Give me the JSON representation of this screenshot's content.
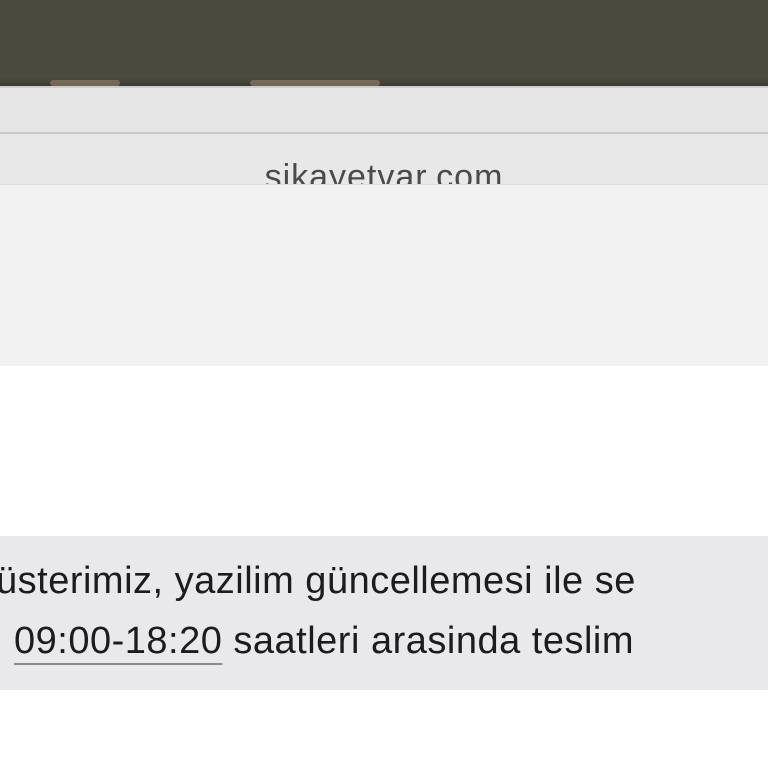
{
  "browser": {
    "address": "sikayetvar.com"
  },
  "message": {
    "line1": "üsterimiz, yazilim güncellemesi ile se",
    "line2_time": "09:00-18:20",
    "line2_rest": " saatleri arasinda teslim"
  },
  "colors": {
    "photo_background": "#4a4b3e",
    "chrome_background": "#e6e6e6",
    "panel_background": "#f2f2f2",
    "bubble_background": "#e9e9eb",
    "message_text": "#1c1c1e"
  }
}
